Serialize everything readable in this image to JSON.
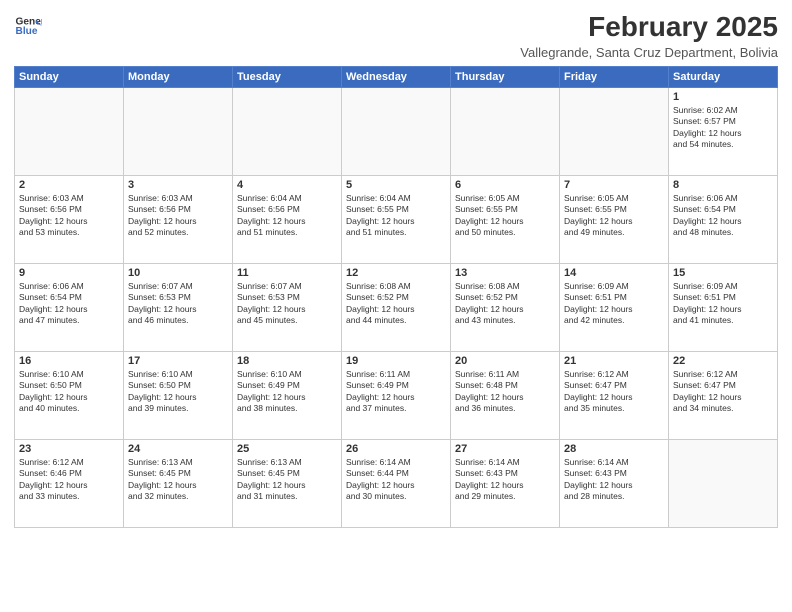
{
  "logo": {
    "line1": "General",
    "line2": "Blue"
  },
  "title": "February 2025",
  "location": "Vallegrande, Santa Cruz Department, Bolivia",
  "headers": [
    "Sunday",
    "Monday",
    "Tuesday",
    "Wednesday",
    "Thursday",
    "Friday",
    "Saturday"
  ],
  "weeks": [
    [
      {
        "day": "",
        "info": "",
        "empty": true
      },
      {
        "day": "",
        "info": "",
        "empty": true
      },
      {
        "day": "",
        "info": "",
        "empty": true
      },
      {
        "day": "",
        "info": "",
        "empty": true
      },
      {
        "day": "",
        "info": "",
        "empty": true
      },
      {
        "day": "",
        "info": "",
        "empty": true
      },
      {
        "day": "1",
        "info": "Sunrise: 6:02 AM\nSunset: 6:57 PM\nDaylight: 12 hours\nand 54 minutes."
      }
    ],
    [
      {
        "day": "2",
        "info": "Sunrise: 6:03 AM\nSunset: 6:56 PM\nDaylight: 12 hours\nand 53 minutes."
      },
      {
        "day": "3",
        "info": "Sunrise: 6:03 AM\nSunset: 6:56 PM\nDaylight: 12 hours\nand 52 minutes."
      },
      {
        "day": "4",
        "info": "Sunrise: 6:04 AM\nSunset: 6:56 PM\nDaylight: 12 hours\nand 51 minutes."
      },
      {
        "day": "5",
        "info": "Sunrise: 6:04 AM\nSunset: 6:55 PM\nDaylight: 12 hours\nand 51 minutes."
      },
      {
        "day": "6",
        "info": "Sunrise: 6:05 AM\nSunset: 6:55 PM\nDaylight: 12 hours\nand 50 minutes."
      },
      {
        "day": "7",
        "info": "Sunrise: 6:05 AM\nSunset: 6:55 PM\nDaylight: 12 hours\nand 49 minutes."
      },
      {
        "day": "8",
        "info": "Sunrise: 6:06 AM\nSunset: 6:54 PM\nDaylight: 12 hours\nand 48 minutes."
      }
    ],
    [
      {
        "day": "9",
        "info": "Sunrise: 6:06 AM\nSunset: 6:54 PM\nDaylight: 12 hours\nand 47 minutes."
      },
      {
        "day": "10",
        "info": "Sunrise: 6:07 AM\nSunset: 6:53 PM\nDaylight: 12 hours\nand 46 minutes."
      },
      {
        "day": "11",
        "info": "Sunrise: 6:07 AM\nSunset: 6:53 PM\nDaylight: 12 hours\nand 45 minutes."
      },
      {
        "day": "12",
        "info": "Sunrise: 6:08 AM\nSunset: 6:52 PM\nDaylight: 12 hours\nand 44 minutes."
      },
      {
        "day": "13",
        "info": "Sunrise: 6:08 AM\nSunset: 6:52 PM\nDaylight: 12 hours\nand 43 minutes."
      },
      {
        "day": "14",
        "info": "Sunrise: 6:09 AM\nSunset: 6:51 PM\nDaylight: 12 hours\nand 42 minutes."
      },
      {
        "day": "15",
        "info": "Sunrise: 6:09 AM\nSunset: 6:51 PM\nDaylight: 12 hours\nand 41 minutes."
      }
    ],
    [
      {
        "day": "16",
        "info": "Sunrise: 6:10 AM\nSunset: 6:50 PM\nDaylight: 12 hours\nand 40 minutes."
      },
      {
        "day": "17",
        "info": "Sunrise: 6:10 AM\nSunset: 6:50 PM\nDaylight: 12 hours\nand 39 minutes."
      },
      {
        "day": "18",
        "info": "Sunrise: 6:10 AM\nSunset: 6:49 PM\nDaylight: 12 hours\nand 38 minutes."
      },
      {
        "day": "19",
        "info": "Sunrise: 6:11 AM\nSunset: 6:49 PM\nDaylight: 12 hours\nand 37 minutes."
      },
      {
        "day": "20",
        "info": "Sunrise: 6:11 AM\nSunset: 6:48 PM\nDaylight: 12 hours\nand 36 minutes."
      },
      {
        "day": "21",
        "info": "Sunrise: 6:12 AM\nSunset: 6:47 PM\nDaylight: 12 hours\nand 35 minutes."
      },
      {
        "day": "22",
        "info": "Sunrise: 6:12 AM\nSunset: 6:47 PM\nDaylight: 12 hours\nand 34 minutes."
      }
    ],
    [
      {
        "day": "23",
        "info": "Sunrise: 6:12 AM\nSunset: 6:46 PM\nDaylight: 12 hours\nand 33 minutes."
      },
      {
        "day": "24",
        "info": "Sunrise: 6:13 AM\nSunset: 6:45 PM\nDaylight: 12 hours\nand 32 minutes."
      },
      {
        "day": "25",
        "info": "Sunrise: 6:13 AM\nSunset: 6:45 PM\nDaylight: 12 hours\nand 31 minutes."
      },
      {
        "day": "26",
        "info": "Sunrise: 6:14 AM\nSunset: 6:44 PM\nDaylight: 12 hours\nand 30 minutes."
      },
      {
        "day": "27",
        "info": "Sunrise: 6:14 AM\nSunset: 6:43 PM\nDaylight: 12 hours\nand 29 minutes."
      },
      {
        "day": "28",
        "info": "Sunrise: 6:14 AM\nSunset: 6:43 PM\nDaylight: 12 hours\nand 28 minutes."
      },
      {
        "day": "",
        "info": "",
        "empty": true
      }
    ]
  ]
}
